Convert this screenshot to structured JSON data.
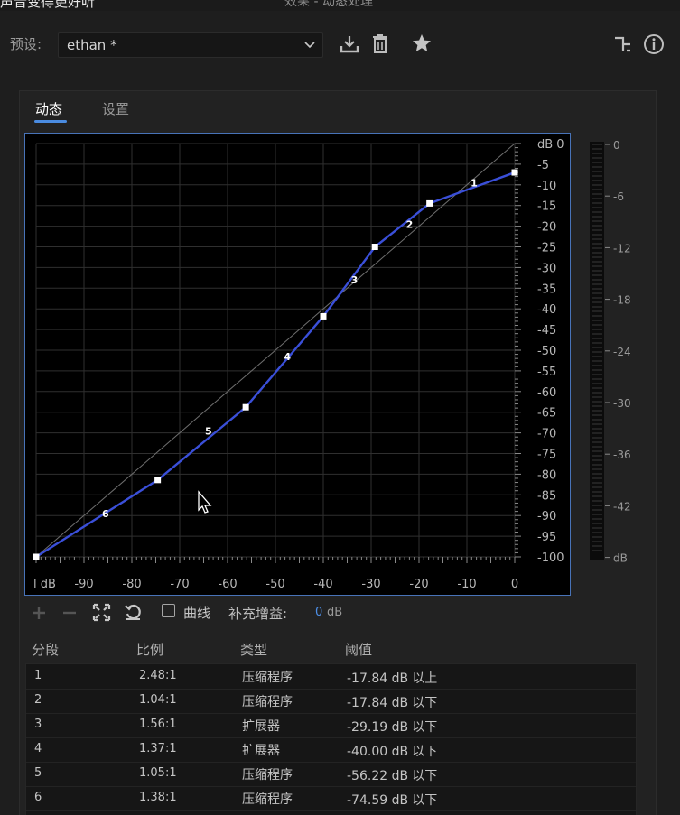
{
  "window": {
    "app_title": "声音变得更好听",
    "title": "效果 - 动态处理"
  },
  "preset": {
    "label": "预设:",
    "value": "ethan *"
  },
  "tabs": [
    "动态",
    "设置"
  ],
  "graph": {
    "y_axis_ticks": [
      "dB 0",
      "-5",
      "-10",
      "-15",
      "-20",
      "-25",
      "-30",
      "-35",
      "-40",
      "-45",
      "-50",
      "-55",
      "-60",
      "-65",
      "-70",
      "-75",
      "-80",
      "-85",
      "-90",
      "-95",
      "-100"
    ],
    "x_axis_ticks": [
      "l dB",
      "-90",
      "-80",
      "-70",
      "-60",
      "-50",
      "-40",
      "-30",
      "-20",
      "-10",
      "0"
    ],
    "segment_labels": [
      "1",
      "2",
      "3",
      "4",
      "5",
      "6"
    ],
    "curve_points": [
      [
        -100,
        -100
      ],
      [
        -74.6,
        -81.4
      ],
      [
        -56.2,
        -63.8
      ],
      [
        -40,
        -41.8
      ],
      [
        -29.2,
        -25
      ],
      [
        -17.8,
        -14.5
      ],
      [
        0,
        -7
      ]
    ],
    "label_positions": [
      [
        -8.5,
        -9.5
      ],
      [
        -22,
        -19.5
      ],
      [
        -33.5,
        -33
      ],
      [
        -47.5,
        -51.5
      ],
      [
        -64,
        -69.5
      ],
      [
        -85.5,
        -89.5
      ]
    ],
    "accent_color": "#3a4fd8",
    "grid_color": "#2f2f2f"
  },
  "meter": {
    "ticks": [
      "0",
      "-6",
      "-12",
      "-18",
      "-24",
      "-30",
      "-36",
      "-42",
      "dB"
    ]
  },
  "toolbar": {
    "add_icon": "plus-icon",
    "remove_icon": "minus-icon",
    "fit_icon": "fit-icon",
    "reset_icon": "reset-icon",
    "curve_label": "曲线",
    "makeup_gain_label": "补充增益:",
    "makeup_gain_value": "0",
    "makeup_gain_unit": "dB"
  },
  "table": {
    "headers": [
      "分段",
      "比例",
      "类型",
      "阈值"
    ],
    "rows": [
      [
        "1",
        "2.48:1",
        "压缩程序",
        "-17.84 dB",
        "以上"
      ],
      [
        "2",
        "1.04:1",
        "压缩程序",
        "-17.84 dB",
        "以下"
      ],
      [
        "3",
        "1.56:1",
        "扩展器",
        "-29.19 dB",
        "以下"
      ],
      [
        "4",
        "1.37:1",
        "扩展器",
        "-40.00 dB",
        "以下"
      ],
      [
        "5",
        "1.05:1",
        "压缩程序",
        "-56.22 dB",
        "以下"
      ],
      [
        "6",
        "1.38:1",
        "压缩程序",
        "-74.59 dB",
        "以下"
      ]
    ]
  }
}
